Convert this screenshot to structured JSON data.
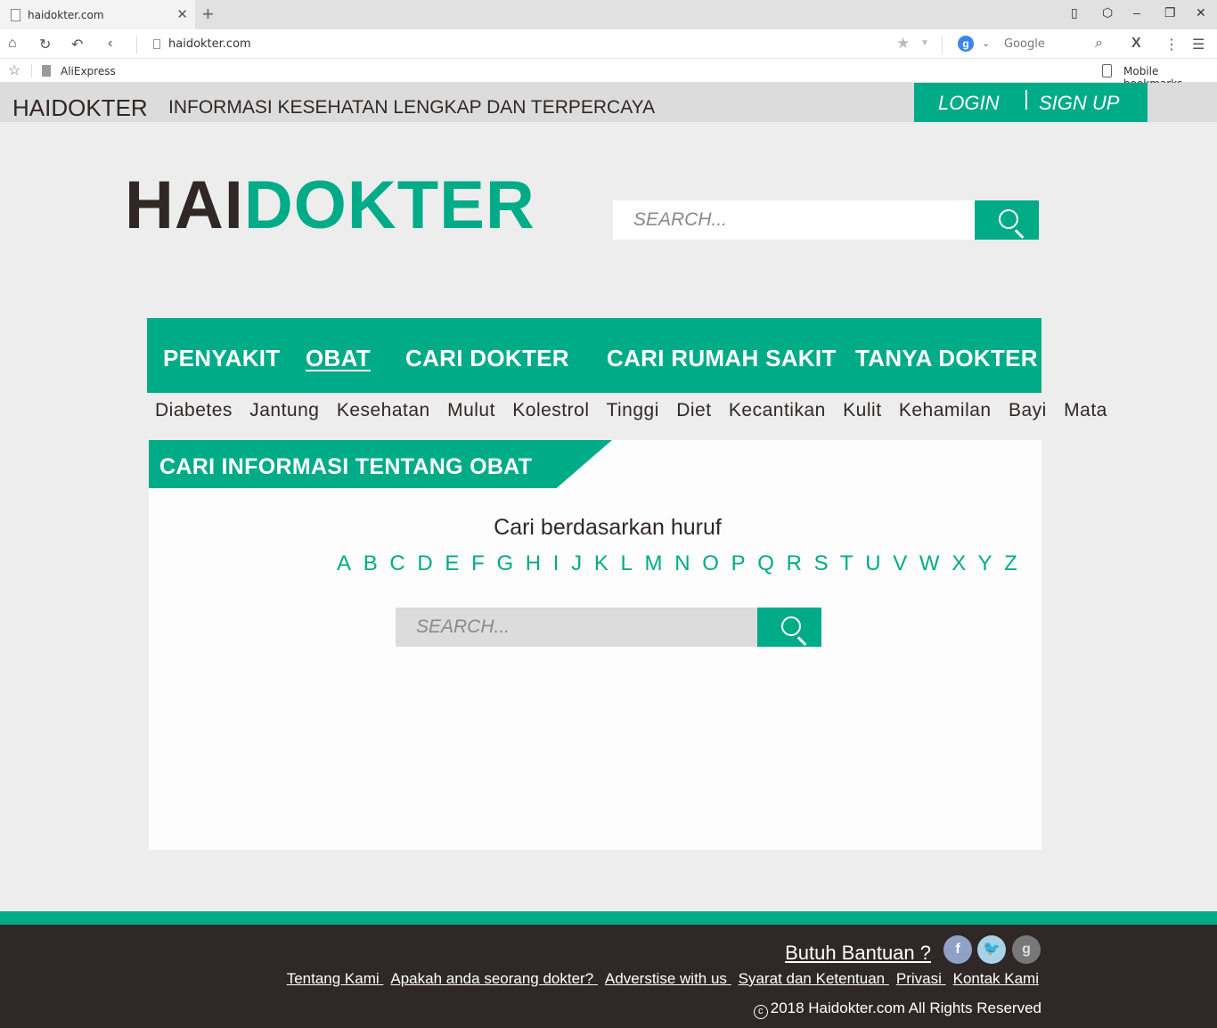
{
  "browser": {
    "tab_title": "haidokter.com",
    "url": "haidokter.com",
    "search_engine": "Google",
    "bookmarks": [
      "AliExpress"
    ],
    "mobile_bookmarks": "Mobile bookmarks"
  },
  "header": {
    "brand": "HAIDOKTER",
    "tagline": "INFORMASI KESEHATAN LENGKAP DAN TERPERCAYA",
    "login": "LOGIN",
    "signup": "SIGN UP"
  },
  "logo": {
    "part1": "HAI",
    "part2": "DOKTER"
  },
  "search": {
    "placeholder": "SEARCH..."
  },
  "nav": {
    "items": [
      "PENYAKIT",
      "OBAT",
      "CARI DOKTER",
      "CARI RUMAH SAKIT",
      "TANYA DOKTER"
    ],
    "active": "OBAT"
  },
  "categories": [
    "Diabetes",
    "Jantung",
    "Kesehatan",
    "Mulut",
    "Kolestrol",
    "Tinggi",
    "Diet",
    "Kecantikan",
    "Kulit",
    "Kehamilan",
    "Bayi",
    "Mata"
  ],
  "panel": {
    "title": "CARI INFORMASI TENTANG OBAT",
    "subtitle": "Cari berdasarkan huruf",
    "letters": [
      "A",
      "B",
      "C",
      "D",
      "E",
      "F",
      "G",
      "H",
      "I",
      "J",
      "K",
      "L",
      "M",
      "N",
      "O",
      "P",
      "Q",
      "R",
      "S",
      "T",
      "U",
      "V",
      "W",
      "X",
      "Y",
      "Z"
    ],
    "search_placeholder": "SEARCH..."
  },
  "footer": {
    "help": "Butuh Bantuan ?",
    "links": [
      "Tentang Kami",
      "Apakah anda seorang dokter?",
      "Adverstise with us",
      "Syarat dan Ketentuan",
      "Privasi",
      "Kontak Kami"
    ],
    "copyright": "2018 Haidokter.com All Rights Reserved",
    "social": [
      "facebook-icon",
      "twitter-icon",
      "google-plus-icon"
    ]
  },
  "colors": {
    "brand_green": "#00ab87",
    "dark": "#302826",
    "bg": "#ededed"
  }
}
